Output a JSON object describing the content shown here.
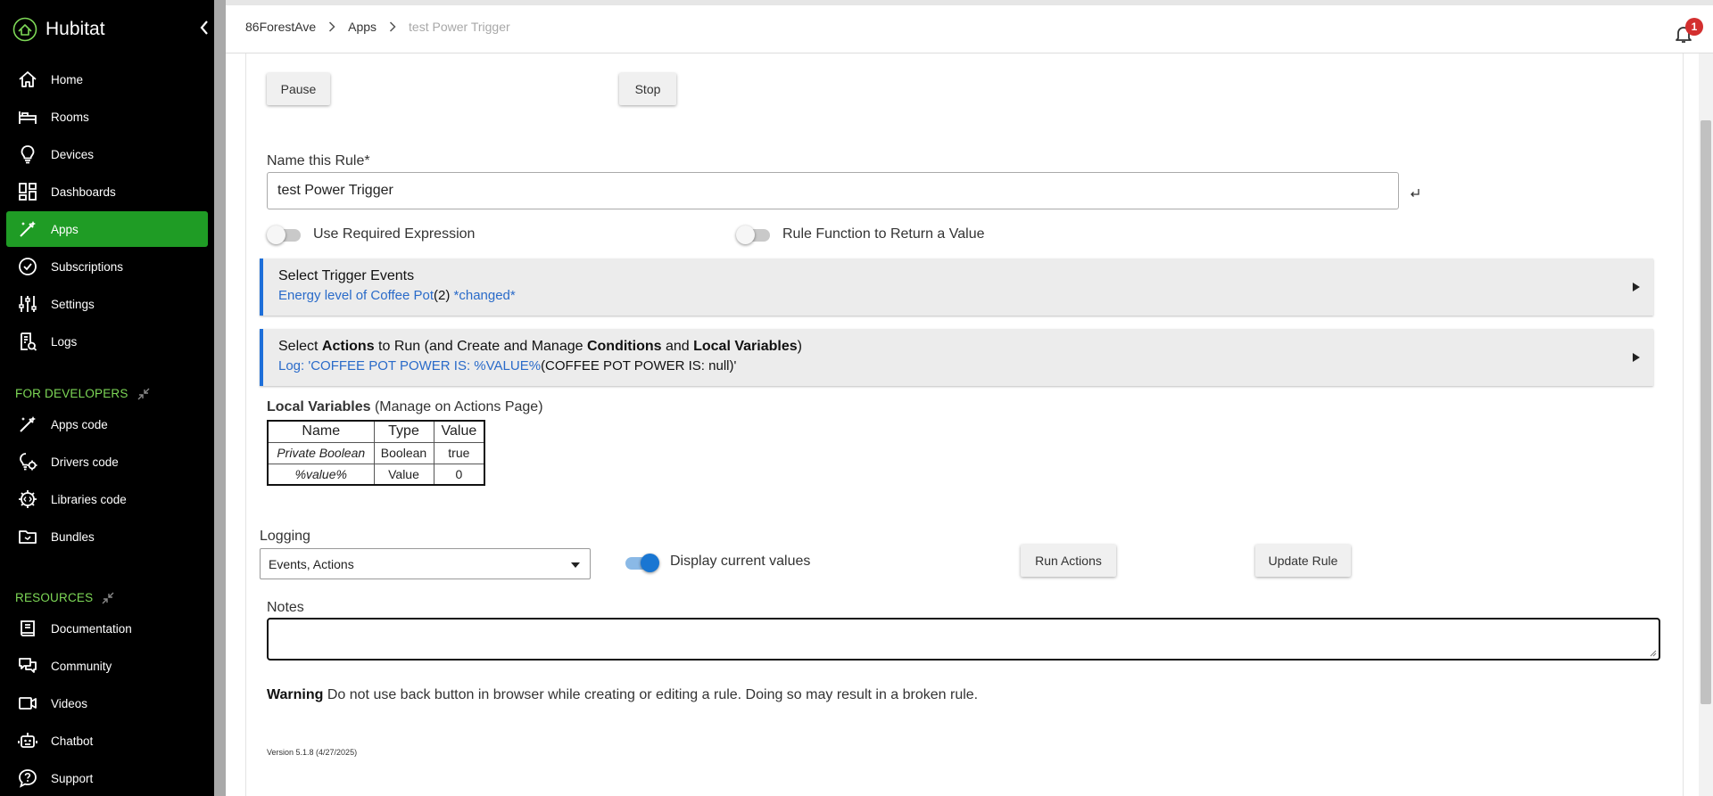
{
  "sidebar": {
    "brand": "Hubitat",
    "nav": [
      {
        "label": "Home",
        "icon": "home-icon"
      },
      {
        "label": "Rooms",
        "icon": "bed-icon"
      },
      {
        "label": "Devices",
        "icon": "bulb-icon"
      },
      {
        "label": "Dashboards",
        "icon": "dashboard-icon"
      },
      {
        "label": "Apps",
        "icon": "magic-wand-icon",
        "active": true
      },
      {
        "label": "Subscriptions",
        "icon": "check-circle-icon"
      },
      {
        "label": "Settings",
        "icon": "sliders-icon"
      },
      {
        "label": "Logs",
        "icon": "log-icon"
      }
    ],
    "dev_heading": "FOR DEVELOPERS",
    "dev_nav": [
      {
        "label": "Apps code",
        "icon": "magic-wand-icon"
      },
      {
        "label": "Drivers code",
        "icon": "bulb-gear-icon"
      },
      {
        "label": "Libraries code",
        "icon": "gear-code-icon"
      },
      {
        "label": "Bundles",
        "icon": "folder-icon"
      }
    ],
    "res_heading": "RESOURCES",
    "res_nav": [
      {
        "label": "Documentation",
        "icon": "book-icon"
      },
      {
        "label": "Community",
        "icon": "chat-icon"
      },
      {
        "label": "Videos",
        "icon": "video-icon"
      },
      {
        "label": "Chatbot",
        "icon": "robot-icon"
      },
      {
        "label": "Support",
        "icon": "help-chat-icon"
      }
    ],
    "accent": "#1f9c25",
    "section_color": "#7ed957"
  },
  "header": {
    "breadcrumbs": [
      "86ForestAve",
      "Apps",
      "test Power Trigger"
    ],
    "notification_count": "1"
  },
  "main": {
    "pause_label": "Pause",
    "stop_label": "Stop",
    "name_label": "Name this Rule*",
    "name_value": "test Power Trigger",
    "toggle_required_label": "Use Required Expression",
    "toggle_required_on": false,
    "toggle_function_label": "Rule Function to Return a Value",
    "toggle_function_on": false,
    "trigger_panel": {
      "title": "Select Trigger Events",
      "sub_part1": "Energy level of Coffee Pot",
      "sub_part2": "(2)",
      "sub_part3": " *changed*"
    },
    "actions_panel": {
      "t1": "Select ",
      "t2": "Actions",
      "t3": " to Run (and Create and Manage ",
      "t4": "Conditions",
      "t5": " and ",
      "t6": "Local Variables",
      "t7": ")",
      "sub_part1": "Log: 'COFFEE POT POWER IS:  %VALUE%",
      "sub_part2": "(COFFEE POT POWER IS:  null)'"
    },
    "local_vars": {
      "caption_bold": "Local Variables",
      "caption_rest": " (Manage on Actions Page)",
      "headers": [
        "Name",
        "Type",
        "Value"
      ],
      "rows": [
        [
          "Private Boolean",
          "Boolean",
          "true"
        ],
        [
          "%value%",
          "Value",
          "0"
        ]
      ]
    },
    "logging_label": "Logging",
    "logging_value": "Events, Actions",
    "display_values_label": "Display current values",
    "display_values_on": true,
    "run_actions_label": "Run Actions",
    "update_rule_label": "Update Rule",
    "notes_label": "Notes",
    "warning_bold": "Warning",
    "warning_text": " Do not use back button in browser while creating or editing a rule. Doing so may result in a broken rule.",
    "version": "Version 5.1.8 (4/27/2025)"
  }
}
